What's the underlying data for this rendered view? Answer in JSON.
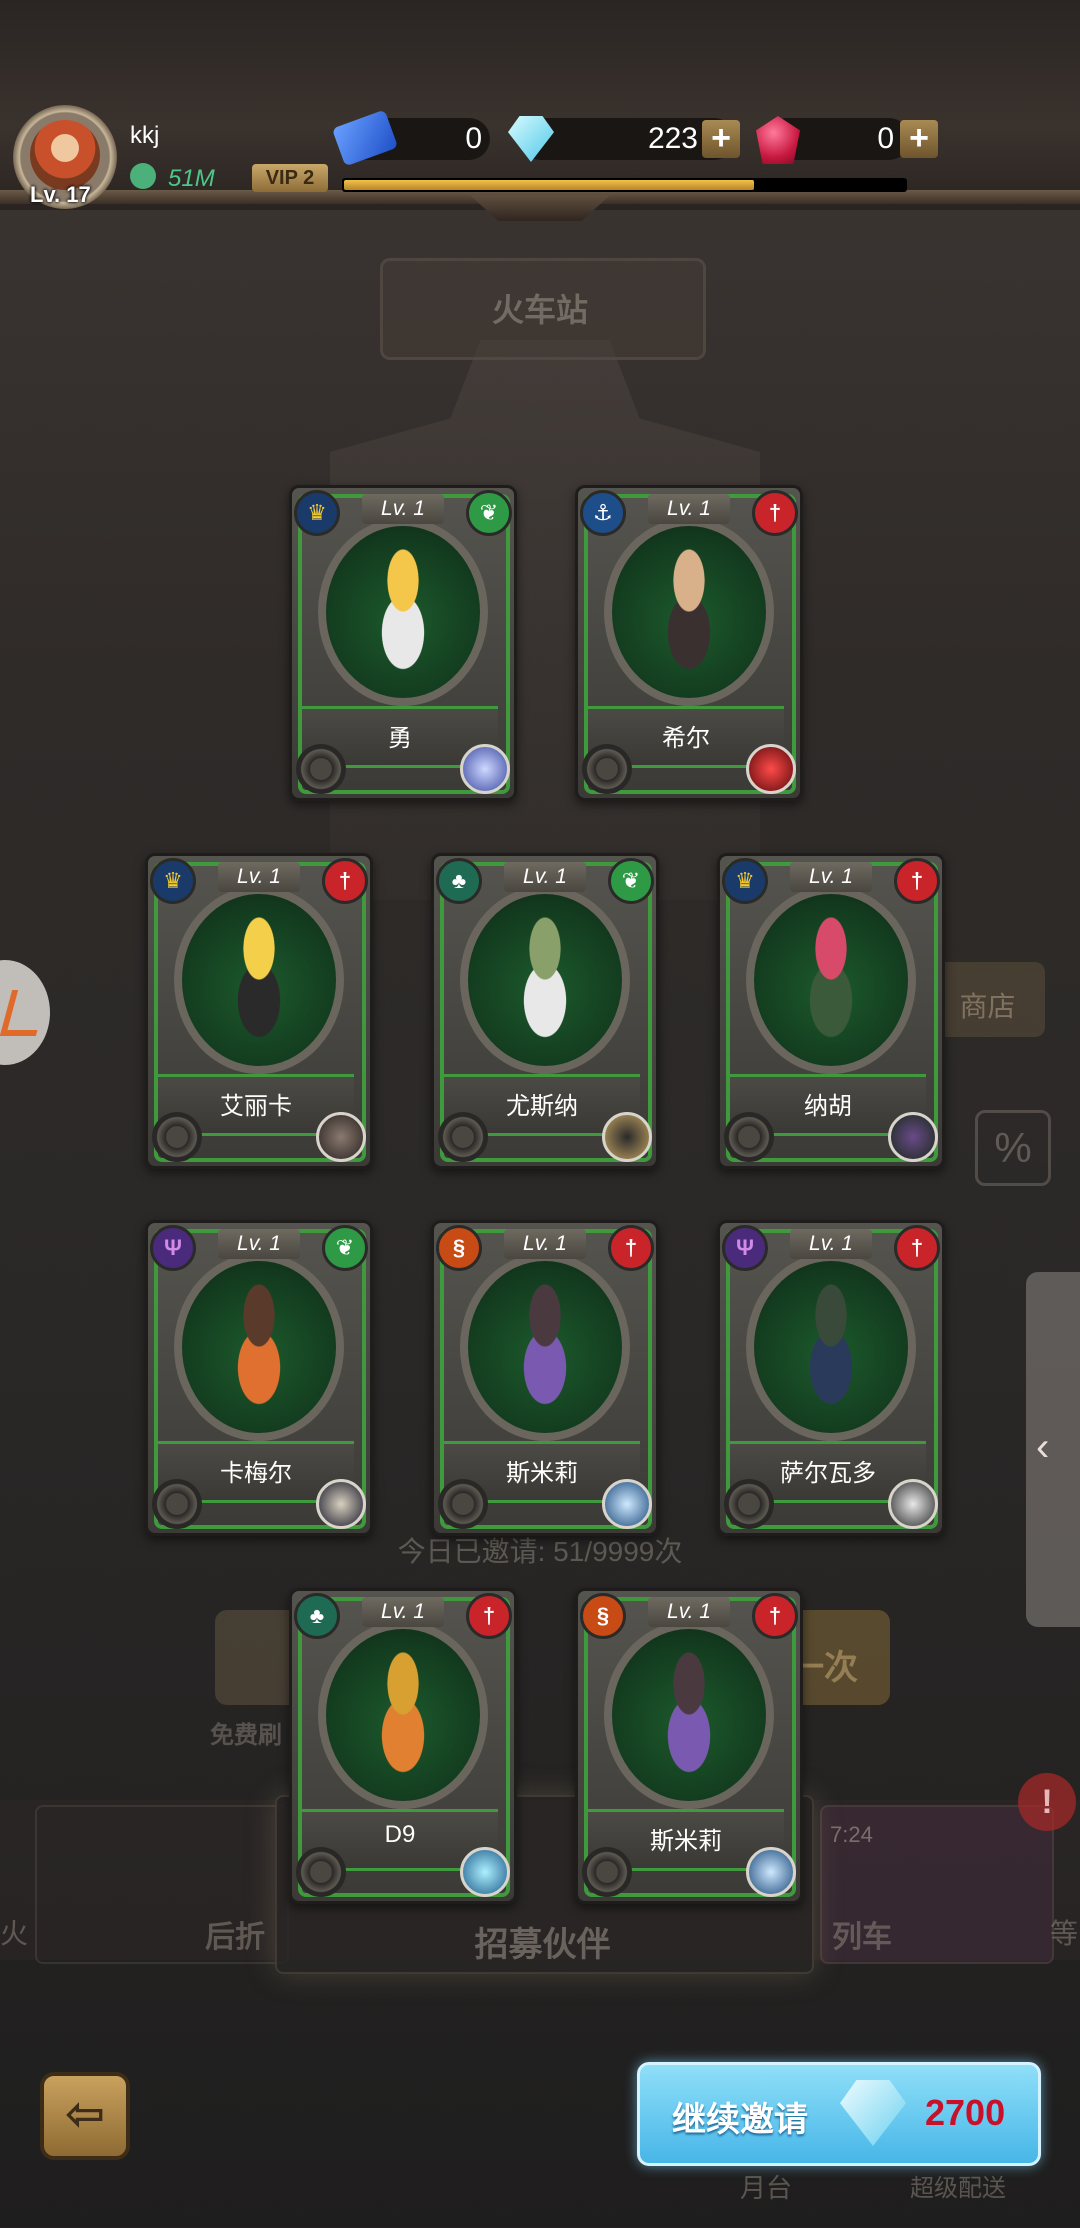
{
  "background": {
    "station_title": "火车站",
    "shop_label": "商店",
    "percent_icon": "percent-icon",
    "invite_count": "今日已邀请: 51/9999次",
    "free_label": "免费刷",
    "next_label": "一次",
    "recruit_label": "招募伙伴",
    "band_left_1": "火",
    "band_left_2": "后折",
    "band_right_1": "列车",
    "band_right_2": "等",
    "band_time": "7:24",
    "bottom_left": "月台",
    "bottom_right": "超级配送"
  },
  "player": {
    "level": "Lv. 17",
    "name": "kkj",
    "power": "51M",
    "vip": "VIP 2",
    "vip_progress": 0.73
  },
  "resources": {
    "tickets": "0",
    "diamonds": "223",
    "rubies": "0"
  },
  "cards": [
    {
      "level": "Lv. 1",
      "name": "勇",
      "faction": "crown-icon",
      "faction_color": "#f3c82a",
      "type": "leaf-icon",
      "skill": "swirl-icon"
    },
    {
      "level": "Lv. 1",
      "name": "希尔",
      "faction": "anchor-icon",
      "faction_color": "#ffffff",
      "type": "sword-icon",
      "skill": "rose-icon"
    },
    {
      "level": "Lv. 1",
      "name": "艾丽卡",
      "faction": "crown-icon",
      "faction_color": "#f3c82a",
      "type": "sword-icon",
      "skill": "debris-icon"
    },
    {
      "level": "Lv. 1",
      "name": "尤斯纳",
      "faction": "tree-icon",
      "faction_color": "#ffffff",
      "type": "leaf-icon",
      "skill": "mask-icon"
    },
    {
      "level": "Lv. 1",
      "name": "纳胡",
      "faction": "crown-icon",
      "faction_color": "#f3c82a",
      "type": "sword-icon",
      "skill": "creature-icon"
    },
    {
      "level": "Lv. 1",
      "name": "卡梅尔",
      "faction": "trident-icon",
      "faction_color": "#d18ae8",
      "type": "leaf-icon",
      "skill": "moon-icon"
    },
    {
      "level": "Lv. 1",
      "name": "斯米莉",
      "faction": "dragon-icon",
      "faction_color": "#ffffff",
      "type": "sword-icon",
      "skill": "wave-icon"
    },
    {
      "level": "Lv. 1",
      "name": "萨尔瓦多",
      "faction": "trident-icon",
      "faction_color": "#d18ae8",
      "type": "sword-icon",
      "skill": "spirit-icon"
    },
    {
      "level": "Lv. 1",
      "name": "D9",
      "faction": "tree-icon",
      "faction_color": "#ffffff",
      "type": "sword-icon",
      "skill": "lightning-icon"
    },
    {
      "level": "Lv. 1",
      "name": "斯米莉",
      "faction": "dragon-icon",
      "faction_color": "#ffffff",
      "type": "sword-icon",
      "skill": "wave-icon"
    }
  ],
  "actions": {
    "continue_label": "继续邀请",
    "continue_cost": "2700"
  }
}
